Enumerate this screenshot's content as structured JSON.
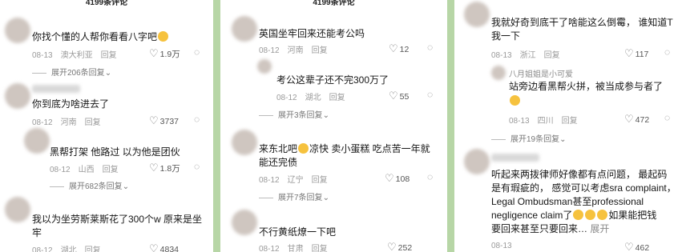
{
  "panel1": {
    "header": "4199条评论",
    "c1": {
      "text": "你找个懂的人帮你看看八字吧",
      "date": "08-13",
      "loc": "澳大利亚",
      "reply": "回复",
      "likes": "1.9万",
      "expand": "展开206条回复"
    },
    "c2": {
      "text": "你到底为啥进去了",
      "date": "08-12",
      "loc": "河南",
      "reply": "回复",
      "likes": "3737"
    },
    "c3": {
      "text": "黑帮打架 他路过 以为他是团伙",
      "date": "08-12",
      "loc": "山西",
      "reply": "回复",
      "likes": "1.8万",
      "expand": "展开682条回复"
    },
    "c4": {
      "line1": "我以为坐劳斯莱斯花了300个w  原来是坐",
      "line2": "牢",
      "date": "08-12",
      "loc": "湖北",
      "reply": "回复",
      "likes": "4834"
    }
  },
  "panel2": {
    "header": "4199条评论",
    "c1": {
      "text": "英国坐牢回来还能考公吗",
      "date": "08-12",
      "loc": "河南",
      "reply": "回复",
      "likes": "12"
    },
    "c2": {
      "text": "考公这辈子还不完300万了",
      "date": "08-12",
      "loc": "湖北",
      "reply": "回复",
      "likes": "55",
      "expand": "展开3条回复"
    },
    "c3": {
      "line1a": "来东北吧",
      "line1b": "凉快  卖小蛋糕  吃点苦一年就",
      "line2": "能还完债",
      "date": "08-12",
      "loc": "辽宁",
      "reply": "回复",
      "likes": "108",
      "expand": "展开7条回复"
    },
    "c4": {
      "text": "不行黄纸燎一下吧",
      "date": "08-12",
      "loc": "甘肃",
      "reply": "回复",
      "likes": "252"
    }
  },
  "panel3": {
    "c1": {
      "line1": "我就好奇到底干了啥能这么倒霉， 谁知道T",
      "line2": "我一下",
      "date": "08-13",
      "loc": "浙江",
      "reply": "回复",
      "likes": "117"
    },
    "r1": {
      "name": "八月姐姐是小可爱",
      "line1": "站旁边看黑帮火拼，被当成参与者了",
      "date": "08-13",
      "loc": "四川",
      "reply": "回复",
      "likes": "472",
      "expand": "展开19条回复"
    },
    "c2": {
      "line1": "听起来两拨律师好像都有点问题， 最起码",
      "line2": "是有瑕疵的， 感觉可以考虑sra complaint，",
      "line3": "Legal Ombudsman甚至professional",
      "line4a": "negligence claim了",
      "line4b": "如果能把钱",
      "line5": "要回来甚至只要回来…",
      "more": "展开",
      "date": "08-13",
      "loc": "",
      "likes": "462"
    }
  },
  "colors": {
    "background": "#b7d6a6",
    "panel": "#ffffff",
    "meta": "#9a9a9a"
  },
  "icons": [
    "heart-icon",
    "dislike-icon",
    "emoji-icon"
  ]
}
